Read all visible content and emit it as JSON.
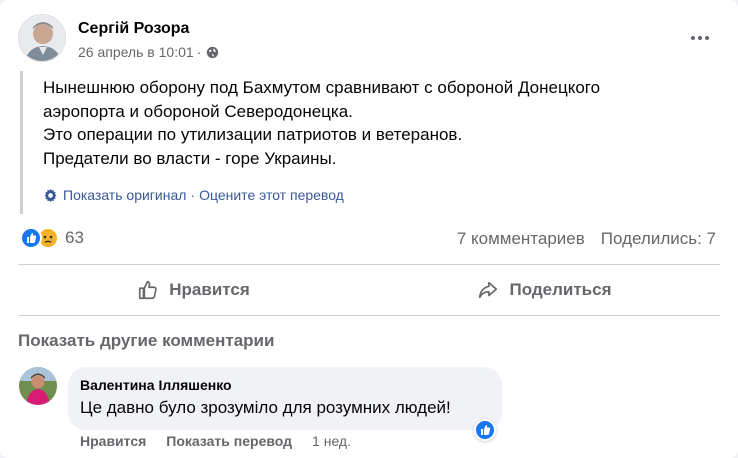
{
  "post": {
    "author": "Сергій Розора",
    "date": "26 апрель в 10:01",
    "separator": "·",
    "text_lines": [
      "Нынешнюю оборону под Бахмутом сравнивают с обороной Донецкого",
      "аэропорта и обороной Северодонецка.",
      "Это операции по утилизации патриотов и ветеранов.",
      "Предатели во власти - горе Украины."
    ],
    "show_original": "Показать оригинал",
    "dot": "·",
    "rate_translation": "Оцените этот перевод"
  },
  "stats": {
    "reaction_count": "63",
    "comments": "7 комментариев",
    "shares": "Поделились: 7"
  },
  "actions": {
    "like": "Нравится",
    "share": "Поделиться"
  },
  "comments_section": {
    "more_comments": "Показать другие комментарии",
    "comment": {
      "author": "Валентина Ілляшенко",
      "text": "Це давно було зрозуміло для розумних людей!",
      "like": "Нравится",
      "translate": "Показать перевод",
      "time": "1 нед."
    }
  },
  "colors": {
    "link": "#385898",
    "secondary": "#65676b",
    "like_blue": "#1877f2",
    "sad_yellow": "#f7b125"
  }
}
